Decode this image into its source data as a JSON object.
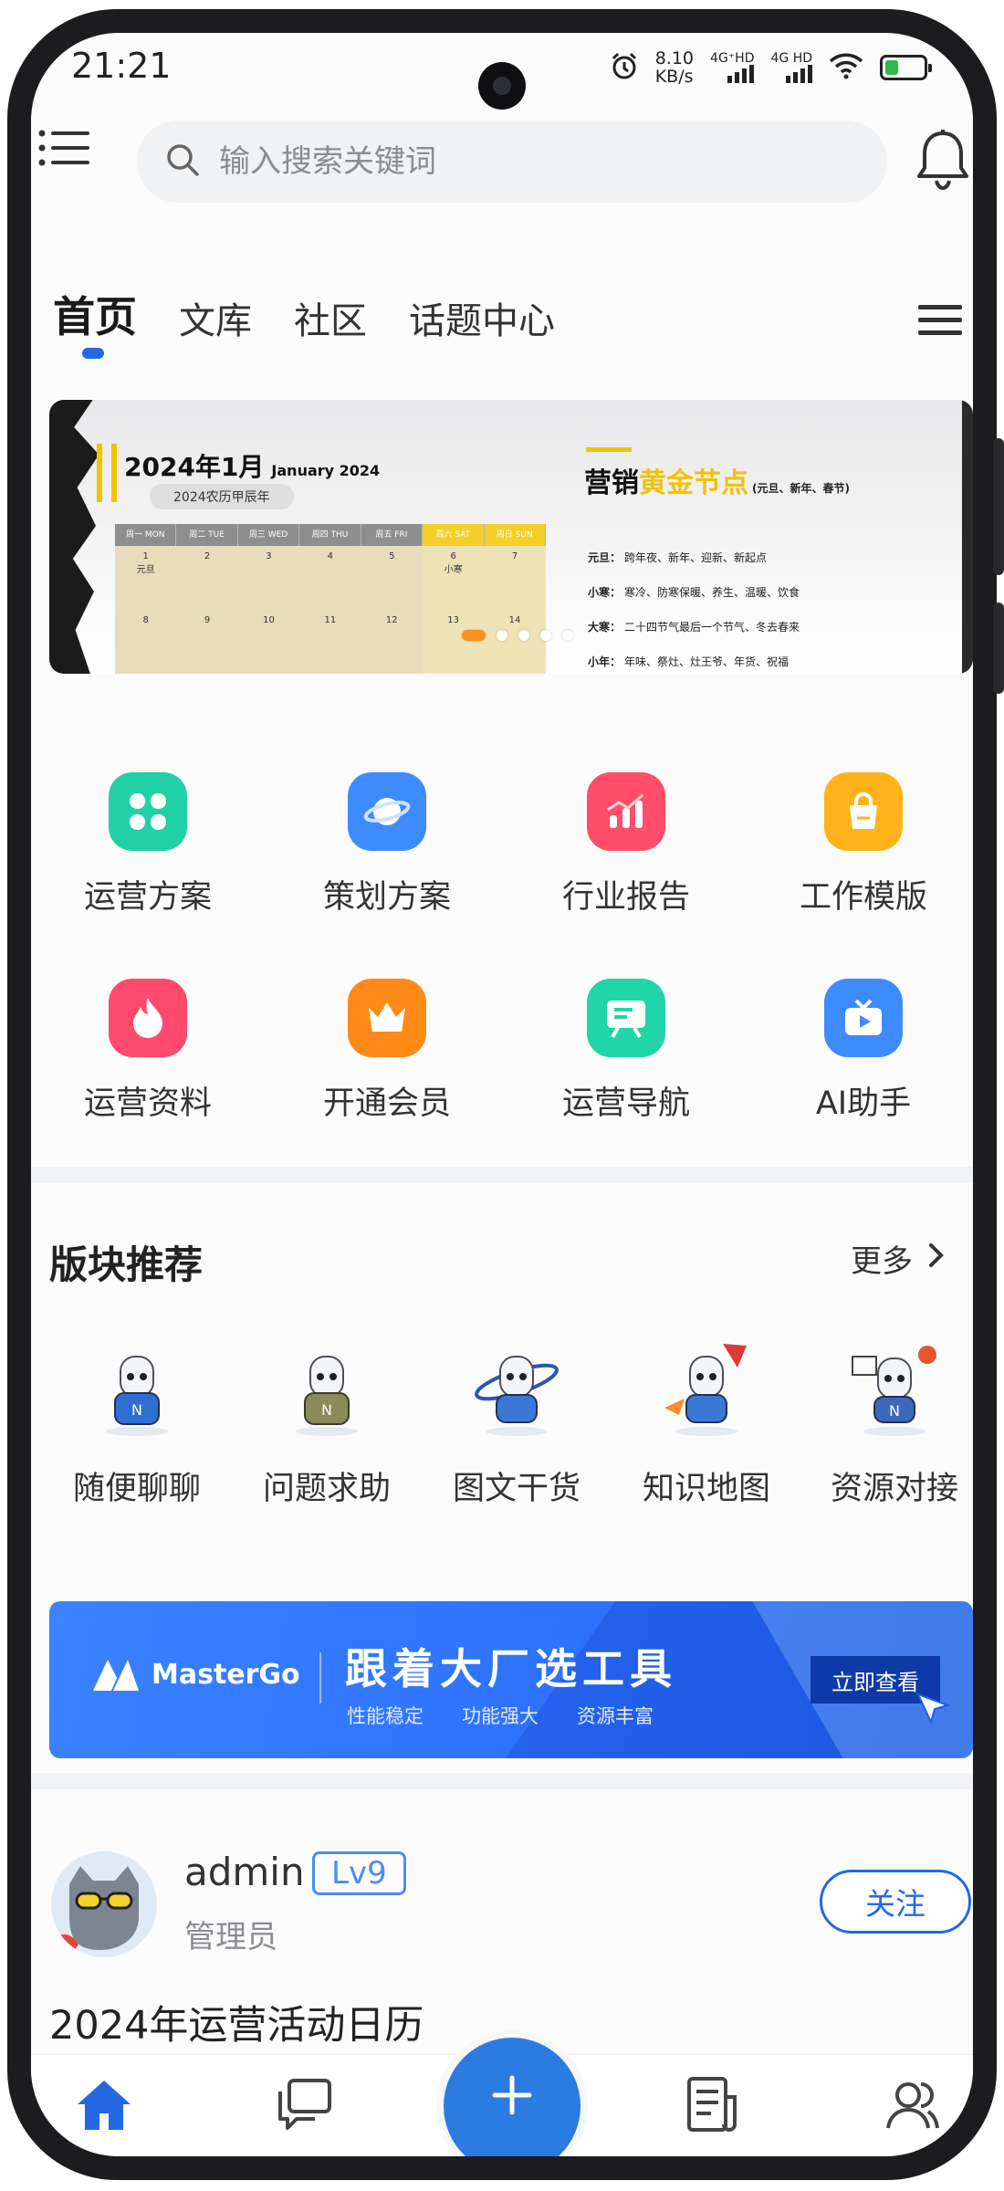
{
  "status_bar": {
    "time": "21:21",
    "net_speed_value": "8.10",
    "net_speed_unit": "KB/s",
    "sim1_label": "4G⁺HD",
    "sim2_label": "4G HD",
    "battery_level": 0.35,
    "icons": [
      "alarm-icon",
      "signal-icon",
      "wifi-icon",
      "battery-icon"
    ]
  },
  "header": {
    "search_placeholder": "输入搜索关键词"
  },
  "tabs": [
    {
      "label": "首页",
      "active": true
    },
    {
      "label": "文库",
      "active": false
    },
    {
      "label": "社区",
      "active": false
    },
    {
      "label": "话题中心",
      "active": false
    }
  ],
  "banner": {
    "calendar_title": "2024年1月",
    "calendar_title_en": "January 2024",
    "calendar_subtitle": "2024农历甲辰年",
    "weekdays": [
      "周一 MON",
      "周二 TUE",
      "周三 WED",
      "周四 THU",
      "周五 FRI",
      "周六 SAT",
      "周日 SUN"
    ],
    "days_row1": [
      "1",
      "2",
      "3",
      "4",
      "5",
      "6",
      "7"
    ],
    "day1_note": "元旦",
    "day6_note": "小寒",
    "days_row2": [
      "8",
      "9",
      "10",
      "11",
      "12",
      "13",
      "14"
    ],
    "marketing_title_a": "营销",
    "marketing_title_b": "黄金节点",
    "marketing_title_note": "(元旦、新年、春节)",
    "marketing_items": [
      {
        "key": "元旦：",
        "value": "跨年夜、新年、迎新、新起点"
      },
      {
        "key": "小寒：",
        "value": "寒冷、防寒保暖、养生、温暖、饮食"
      },
      {
        "key": "大寒：",
        "value": "二十四节气最后一个节气、冬去春来"
      },
      {
        "key": "小年：",
        "value": "年味、祭灶、灶王爷、年货、祝福"
      }
    ],
    "active_slide": 1,
    "slide_count": 5
  },
  "features": [
    {
      "label": "运营方案",
      "icon": "grid-icon",
      "color": "#1fd1a5"
    },
    {
      "label": "策划方案",
      "icon": "planet-icon",
      "color": "#3d8bff"
    },
    {
      "label": "行业报告",
      "icon": "bar-chart-icon",
      "color": "#ff4d6a"
    },
    {
      "label": "工作模版",
      "icon": "bag-icon",
      "color": "#ffb21a"
    },
    {
      "label": "运营资料",
      "icon": "flame-icon",
      "color": "#ff4a6e"
    },
    {
      "label": "开通会员",
      "icon": "crown-icon",
      "color": "#ff8a17"
    },
    {
      "label": "运营导航",
      "icon": "board-icon",
      "color": "#21d6a6"
    },
    {
      "label": "AI助手",
      "icon": "tv-icon",
      "color": "#3e8bff"
    }
  ],
  "section": {
    "title": "版块推荐",
    "more_label": "更多"
  },
  "boards": [
    {
      "label": "随便聊聊",
      "icon": "cartoon-mascot-icon"
    },
    {
      "label": "问题求助",
      "icon": "cartoon-mascot-icon"
    },
    {
      "label": "图文干货",
      "icon": "cartoon-mascot-icon"
    },
    {
      "label": "知识地图",
      "icon": "cartoon-mascot-icon"
    },
    {
      "label": "资源对接",
      "icon": "cartoon-mascot-icon"
    }
  ],
  "ad": {
    "brand": "MasterGo",
    "title": "跟着大厂选工具",
    "features": [
      "性能稳定",
      "功能强大",
      "资源丰富"
    ],
    "cta": "立即查看"
  },
  "post": {
    "author": "admin",
    "level": "Lv9",
    "role": "管理员",
    "follow_label": "关注",
    "title": "2024年运营活动日历"
  },
  "bottom_nav": [
    "home-icon",
    "chat-icon",
    "add-icon",
    "document-icon",
    "users-icon"
  ],
  "colors": {
    "primary": "#2468e4",
    "fab": "#2c7be0",
    "accent_yellow": "#f2c300",
    "dot_active": "#f5921e"
  }
}
